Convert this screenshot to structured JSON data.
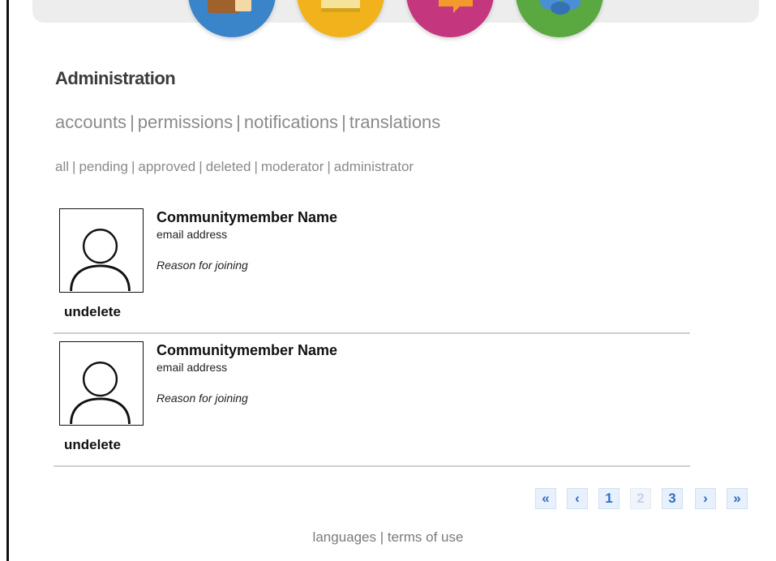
{
  "header": {
    "category_icons": [
      {
        "name": "folder-icon",
        "color": "#3a84c9"
      },
      {
        "name": "document-icon",
        "color": "#f2b21c"
      },
      {
        "name": "speech-bubble-icon",
        "color": "#c4377f"
      },
      {
        "name": "people-icon",
        "color": "#5aa840"
      }
    ]
  },
  "page": {
    "title": "Administration"
  },
  "primary_nav": {
    "items": [
      "accounts",
      "permissions",
      "notifications",
      "translations"
    ],
    "separator": "|"
  },
  "filter_nav": {
    "items": [
      "all",
      "pending",
      "approved",
      "deleted",
      "moderator",
      "administrator"
    ],
    "separator": "|"
  },
  "members": [
    {
      "name": "Communitymember Name",
      "email": "email address",
      "reason": "Reason for joining",
      "action": "undelete"
    },
    {
      "name": "Communitymember Name",
      "email": "email address",
      "reason": "Reason for joining",
      "action": "undelete"
    }
  ],
  "pagination": {
    "first": "«",
    "prev": "‹",
    "pages": [
      "1",
      "2",
      "3"
    ],
    "disabled_page": "2",
    "next": "›",
    "last": "»",
    "accent_color": "#2f6fc6"
  },
  "footer": {
    "languages": "languages",
    "separator": "|",
    "terms": "terms of use"
  }
}
